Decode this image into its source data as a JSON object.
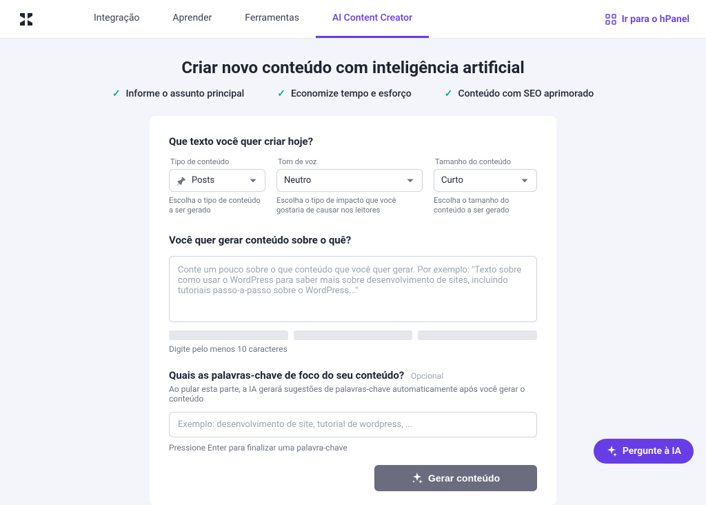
{
  "header": {
    "nav": {
      "integration": "Integração",
      "learn": "Aprender",
      "tools": "Ferramentas",
      "ai_creator": "AI Content Creator"
    },
    "hpanel_link": "Ir para o hPanel"
  },
  "page": {
    "title": "Criar novo conteúdo com inteligência artificial",
    "benefits": {
      "b1": "Informe o assunto principal",
      "b2": "Economize tempo e esforço",
      "b3": "Conteúdo com SEO aprimorado"
    }
  },
  "form": {
    "q1_title": "Que texto você quer criar hoje?",
    "content_type": {
      "label": "Tipo de conteúdo",
      "value": "Posts",
      "help": "Escolha o tipo de conteúdo a ser gerado"
    },
    "tone": {
      "label": "Tom de voz",
      "value": "Neutro",
      "help": "Escolha o tipo de impacto que você gostaria de causar nos leitores"
    },
    "length": {
      "label": "Tamanho do conteúdo",
      "value": "Curto",
      "help": "Escolha o tamanho do conteúdo a ser gerado"
    },
    "q2_title": "Você quer gerar conteúdo sobre o quê?",
    "about_placeholder": "Conte um pouco sobre o que conteúdo que você quer gerar. Por exemplo: \"Texto sobre como usar o WordPress para saber mais sobre desenvolvimento de sites, incluindo tutoriais passo-a-passo sobre o WordPress...\"",
    "char_hint": "Digite pelo menos 10 caracteres",
    "q3_title": "Quais as palavras-chave de foco do seu conteúdo?",
    "q3_optional": "Opcional",
    "q3_subtitle": "Ao pular esta parte, a IA gerará sugestões de palavras-chave automaticamente após você gerar o conteúdo",
    "keywords_placeholder": "Exemplo: desenvolvimento de site, tutorial de wordpress, ...",
    "enter_hint": "Pressione Enter para finalizar uma palavra-chave",
    "generate_btn": "Gerar conteúdo"
  },
  "ask_ai": "Pergunte à IA"
}
